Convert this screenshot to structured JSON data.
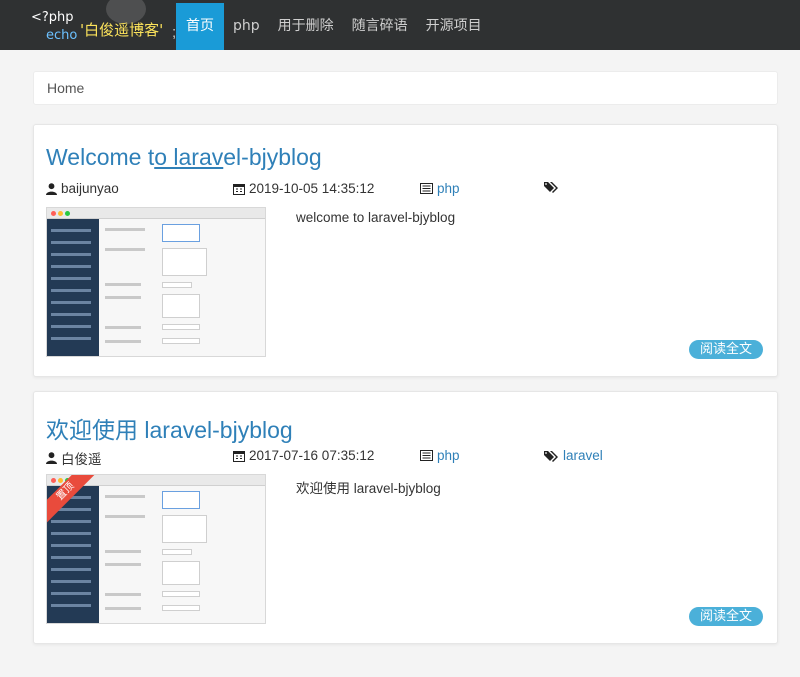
{
  "site": {
    "logo_php": "<?php",
    "logo_echo": "echo",
    "logo_name": "'白俊遥博客'",
    "logo_semicolon": ";"
  },
  "nav": {
    "items": [
      {
        "label": "首页",
        "active": true
      },
      {
        "label": "php",
        "active": false
      },
      {
        "label": "用于删除",
        "active": false
      },
      {
        "label": "随言碎语",
        "active": false
      },
      {
        "label": "开源项目",
        "active": false
      }
    ]
  },
  "breadcrumb": {
    "label": "Home"
  },
  "articles": [
    {
      "title": "Welcome to laravel-bjyblog",
      "title_start": "Welcome t",
      "title_underlined": "o larav",
      "title_end": "el-bjyblog",
      "author": "baijunyao",
      "date": "2019-10-05 14:35:12",
      "category": "php",
      "tags": "",
      "excerpt": "welcome to laravel-bjyblog",
      "read_more": "阅读全文",
      "pinned": false
    },
    {
      "title": "欢迎使用 laravel-bjyblog",
      "author": "白俊遥",
      "date": "2017-07-16 07:35:12",
      "category": "php",
      "tags": "laravel",
      "excerpt": "欢迎使用 laravel-bjyblog",
      "read_more": "阅读全文",
      "pinned": true,
      "pinned_label": "置顶"
    }
  ],
  "colors": {
    "navbar_bg": "#2f3132",
    "nav_active_bg": "#1a9bd7",
    "link": "#2f80b8",
    "read_more_bg": "#4bb0d9",
    "pinned_ribbon": "#e94b3c"
  },
  "icons": {
    "author": "user-icon",
    "date": "calendar-icon",
    "category": "list-icon",
    "tags": "tags-icon"
  }
}
